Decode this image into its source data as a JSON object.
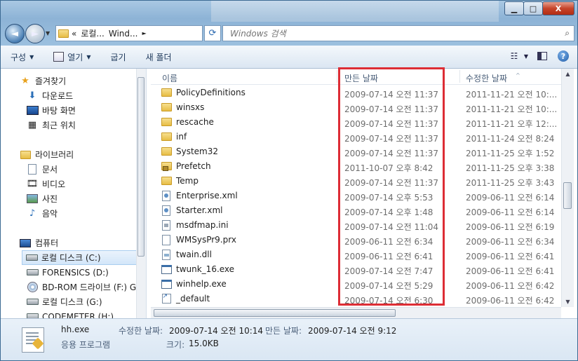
{
  "window": {
    "minimize_label": "▁",
    "maximize_label": "□",
    "close_label": "X"
  },
  "nav": {
    "back_label": "◄",
    "forward_label": "►",
    "address_segments": [
      "«",
      "로컬...",
      "Wind...",
      "►"
    ],
    "search_placeholder": "Windows 검색"
  },
  "toolbar": {
    "organize": "구성",
    "open": "열기",
    "burn": "굽기",
    "new_folder": "새 폴더"
  },
  "navpane": {
    "favorites": "즐겨찾기",
    "favorites_items": [
      "다운로드",
      "바탕 화면",
      "최근 위치"
    ],
    "libraries": "라이브러리",
    "libraries_items": [
      "문서",
      "비디오",
      "사진",
      "음악"
    ],
    "computer": "컴퓨터",
    "drives": [
      "로컬 디스크 (C:)",
      "FORENSICS (D:)",
      "BD-ROM 드라이브 (F:) G",
      "로컬 디스크 (G:)",
      "CODEMETER (H:)"
    ]
  },
  "columns": {
    "name": "이름",
    "date_created": "만든 날짜",
    "date_modified": "수정한 날짜"
  },
  "files": [
    {
      "name": "PolicyDefinitions",
      "created": "2009-07-14 오전 11:37",
      "modified": "2011-11-21 오전 10:...",
      "icon": "folder-icon"
    },
    {
      "name": "winsxs",
      "created": "2009-07-14 오전 11:37",
      "modified": "2011-11-21 오전 10:...",
      "icon": "folder-icon"
    },
    {
      "name": "rescache",
      "created": "2009-07-14 오전 11:37",
      "modified": "2011-11-21 오후 12:...",
      "icon": "folder-icon"
    },
    {
      "name": "inf",
      "created": "2009-07-14 오전 11:37",
      "modified": "2011-11-24 오전 8:24",
      "icon": "folder-icon"
    },
    {
      "name": "System32",
      "created": "2009-07-14 오전 11:37",
      "modified": "2011-11-25 오후 1:52",
      "icon": "folder-icon"
    },
    {
      "name": "Prefetch",
      "created": "2011-10-07 오후 8:42",
      "modified": "2011-11-25 오후 3:38",
      "icon": "locked-folder-icon"
    },
    {
      "name": "Temp",
      "created": "2009-07-14 오전 11:37",
      "modified": "2011-11-25 오후 3:43",
      "icon": "folder-icon"
    },
    {
      "name": "Enterprise.xml",
      "created": "2009-07-14 오후 5:53",
      "modified": "2009-06-11 오전 6:14",
      "icon": "xml-file-icon"
    },
    {
      "name": "Starter.xml",
      "created": "2009-07-14 오후 1:48",
      "modified": "2009-06-11 오전 6:14",
      "icon": "xml-file-icon"
    },
    {
      "name": "msdfmap.ini",
      "created": "2009-07-14 오전 11:04",
      "modified": "2009-06-11 오전 6:19",
      "icon": "ini-file-icon"
    },
    {
      "name": "WMSysPr9.prx",
      "created": "2009-06-11 오전 6:34",
      "modified": "2009-06-11 오전 6:34",
      "icon": "file-icon"
    },
    {
      "name": "twain.dll",
      "created": "2009-06-11 오전 6:41",
      "modified": "2009-06-11 오전 6:41",
      "icon": "dll-file-icon"
    },
    {
      "name": "twunk_16.exe",
      "created": "2009-07-14 오전 7:47",
      "modified": "2009-06-11 오전 6:41",
      "icon": "exe-file-icon"
    },
    {
      "name": "winhelp.exe",
      "created": "2009-07-14 오전 5:29",
      "modified": "2009-06-11 오전 6:42",
      "icon": "exe-file-icon"
    },
    {
      "name": "_default",
      "created": "2009-07-14 오전 6:30",
      "modified": "2009-06-11 오전 6:42",
      "icon": "shortcut-icon"
    }
  ],
  "details": {
    "filename": "hh.exe",
    "type": "응용 프로그램",
    "modified_label": "수정한 날짜:",
    "modified_value": "2009-07-14 오전 10:14",
    "created_label": "만든 날짜:",
    "created_value": "2009-07-14 오전 9:12",
    "size_label": "크기:",
    "size_value": "15.0KB"
  },
  "colors": {
    "highlight_box": "#dd2d35",
    "selection": "#d3e6f9"
  }
}
